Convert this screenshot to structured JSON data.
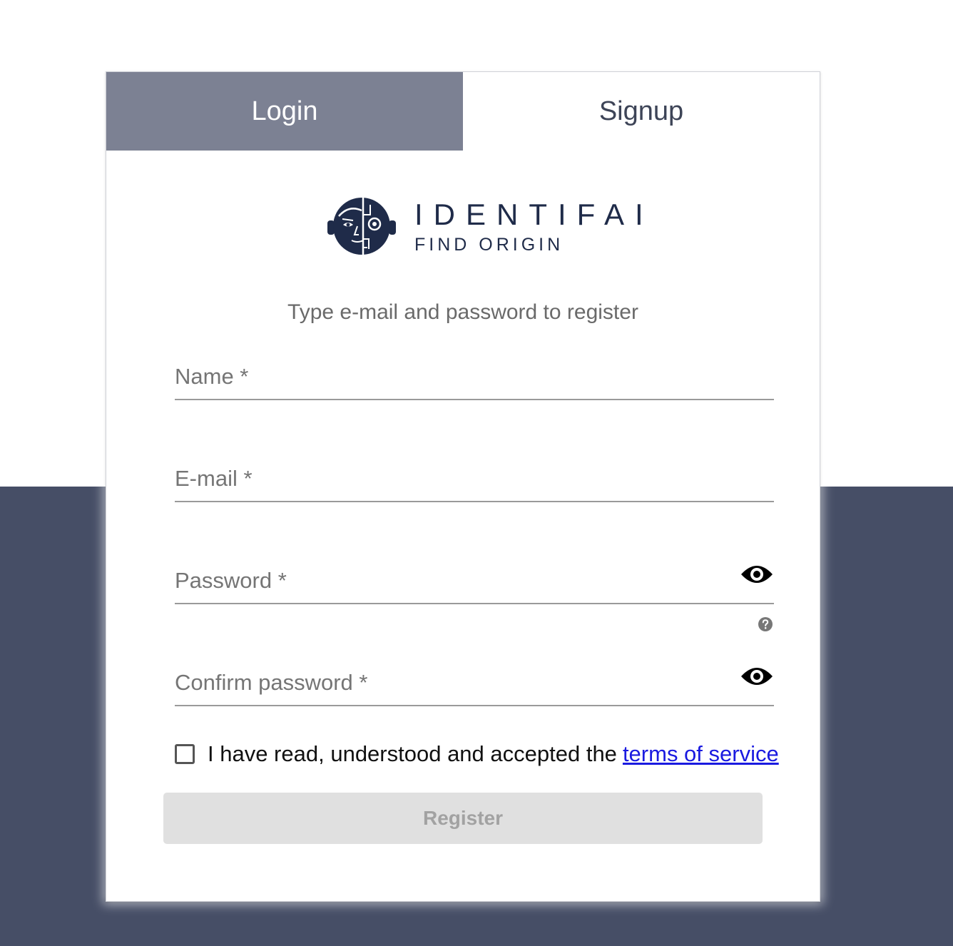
{
  "tabs": {
    "login": "Login",
    "signup": "Signup",
    "active": "Signup"
  },
  "logo": {
    "name": "IDENTIFAI",
    "tagline": "FIND ORIGIN",
    "icon": "half-human-half-robot-face-icon",
    "color": "#1f2b49"
  },
  "form": {
    "subtitle": "Type e-mail and password to register",
    "name_placeholder": "Name *",
    "email_placeholder": "E-mail *",
    "password_placeholder": "Password *",
    "confirm_placeholder": "Confirm password *",
    "password_toggle_icon": "eye-icon",
    "help_icon": "question-circle-icon",
    "terms_text": "I have read, understood and accepted the",
    "terms_link": "terms of service",
    "terms_checked": false,
    "register_label": "Register",
    "register_disabled": true
  },
  "colors": {
    "tab_inactive_bg": "#7c8193",
    "page_dark_bg": "#464e66",
    "link": "#1a1ae0",
    "button_disabled_bg": "#e0e0e0"
  }
}
